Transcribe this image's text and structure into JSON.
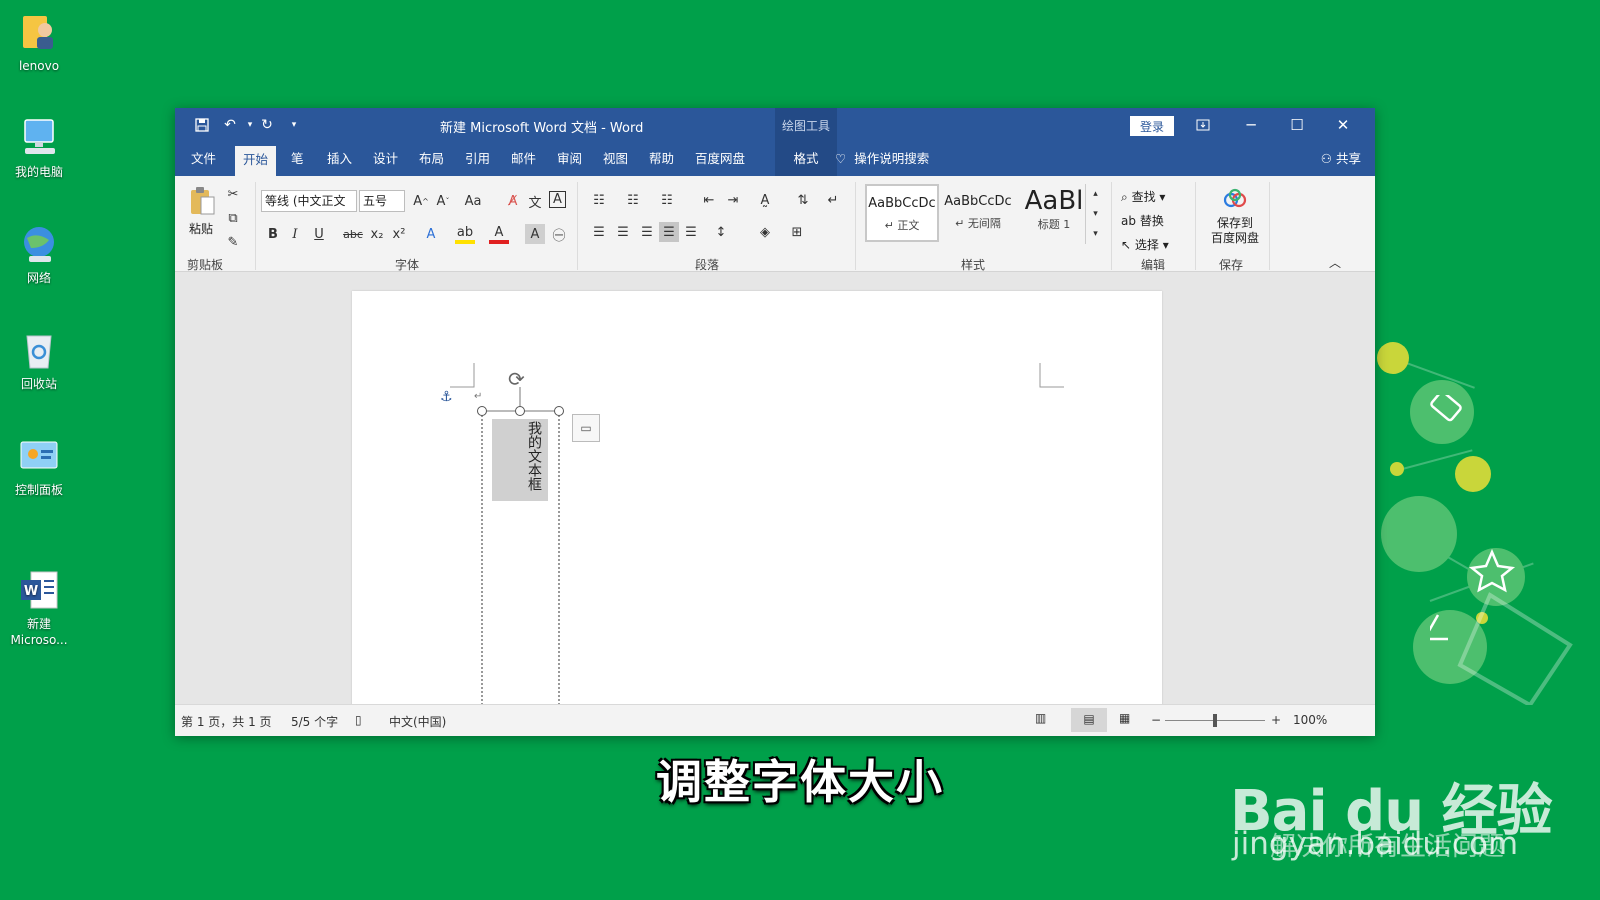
{
  "desktop": {
    "icons": [
      {
        "label": "lenovo"
      },
      {
        "label": "我的电脑"
      },
      {
        "label": "网络"
      },
      {
        "label": "回收站"
      },
      {
        "label": "控制面板"
      },
      {
        "label": "新建\nMicroso..."
      }
    ],
    "background_color": "#00a04a"
  },
  "word": {
    "title": "新建 Microsoft Word 文档  -  Word",
    "context_tool": "绘图工具",
    "login_label": "登录",
    "tabs": [
      {
        "label": "文件"
      },
      {
        "label": "开始"
      },
      {
        "label": "笔"
      },
      {
        "label": "插入"
      },
      {
        "label": "设计"
      },
      {
        "label": "布局"
      },
      {
        "label": "引用"
      },
      {
        "label": "邮件"
      },
      {
        "label": "审阅"
      },
      {
        "label": "视图"
      },
      {
        "label": "帮助"
      },
      {
        "label": "百度网盘"
      },
      {
        "label": "格式"
      }
    ],
    "active_tab": "开始",
    "tell_me": "操作说明搜索",
    "share_label": "共享",
    "ribbon": {
      "clipboard": {
        "paste_label": "粘贴",
        "group_label": "剪贴板"
      },
      "font": {
        "font_name": "等线 (中文正文",
        "font_size": "五号",
        "group_label": "字体"
      },
      "paragraph": {
        "group_label": "段落"
      },
      "styles": {
        "group_label": "样式",
        "items": [
          {
            "sample": "AaBbCcDc",
            "name": "↵ 正文"
          },
          {
            "sample": "AaBbCcDc",
            "name": "↵ 无间隔"
          },
          {
            "sample": "AaBl",
            "name": "标题 1"
          }
        ]
      },
      "editing": {
        "find": "查找",
        "replace": "替换",
        "select": "选择",
        "group_label": "编辑"
      },
      "save": {
        "label_line1": "保存到",
        "label_line2": "百度网盘",
        "group_label": "保存"
      }
    },
    "document": {
      "textbox_text": "我的文本框"
    },
    "status": {
      "page": "第 1 页，共 1 页",
      "words": "5/5 个字",
      "language": "中文(中国)",
      "zoom": "100%",
      "zoom_level": 0.5
    },
    "accent_color": "#2b579a"
  },
  "caption": "调整字体大小",
  "watermark": {
    "brand": "Bai du 经验",
    "subtitle": "jingyan.baidu.com",
    "subtitle_overlay": "解决你所有生活问题"
  }
}
